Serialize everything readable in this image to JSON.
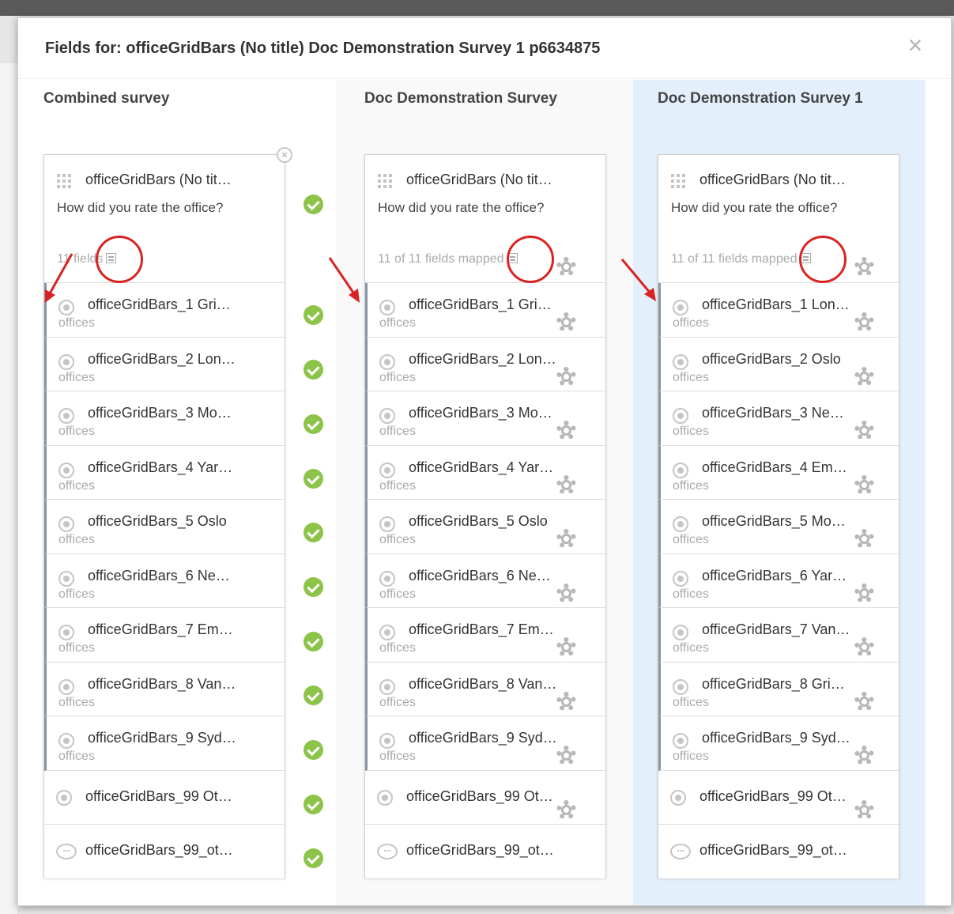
{
  "dialog": {
    "title": "Fields for: officeGridBars (No title) Doc Demonstration Survey 1 p6634875",
    "close_glyph": "×"
  },
  "icons": {
    "question": "grid-icon",
    "meta": "list-icon",
    "field": "radio-icon",
    "open_text": "chat-icon",
    "mapped": "check-icon",
    "settings": "gear-icon",
    "remove": "remove-icon"
  },
  "colors": {
    "check": "#8cc44a",
    "selected_column_bg": "#e3effa",
    "annotation": "#d92323",
    "mapped_bar": "#8896a8"
  },
  "columns": [
    {
      "title": "Combined survey",
      "question": {
        "title": "officeGridBars (No tit…",
        "text": "How did you rate the office?",
        "meta": "11 fields"
      },
      "fields": [
        {
          "label": "officeGridBars_1 Gri…",
          "sub": "offices"
        },
        {
          "label": "officeGridBars_2 Lon…",
          "sub": "offices"
        },
        {
          "label": "officeGridBars_3 Mo…",
          "sub": "offices"
        },
        {
          "label": "officeGridBars_4 Yar…",
          "sub": "offices"
        },
        {
          "label": "officeGridBars_5 Oslo",
          "sub": "offices"
        },
        {
          "label": "officeGridBars_6 Ne…",
          "sub": "offices"
        },
        {
          "label": "officeGridBars_7 Em…",
          "sub": "offices"
        },
        {
          "label": "officeGridBars_8 Van…",
          "sub": "offices"
        },
        {
          "label": "officeGridBars_9 Syd…",
          "sub": "offices"
        },
        {
          "label": "officeGridBars_99 Ot…",
          "sub": ""
        },
        {
          "label": "officeGridBars_99_ot…",
          "sub": ""
        }
      ]
    },
    {
      "title": "Doc Demonstration Survey",
      "question": {
        "title": "officeGridBars (No tit…",
        "text": "How did you rate the office?",
        "meta": "11 of 11 fields mapped"
      },
      "fields": [
        {
          "label": "officeGridBars_1 Gri…",
          "sub": "offices"
        },
        {
          "label": "officeGridBars_2 Lon…",
          "sub": "offices"
        },
        {
          "label": "officeGridBars_3 Mo…",
          "sub": "offices"
        },
        {
          "label": "officeGridBars_4 Yar…",
          "sub": "offices"
        },
        {
          "label": "officeGridBars_5 Oslo",
          "sub": "offices"
        },
        {
          "label": "officeGridBars_6 Ne…",
          "sub": "offices"
        },
        {
          "label": "officeGridBars_7 Em…",
          "sub": "offices"
        },
        {
          "label": "officeGridBars_8 Van…",
          "sub": "offices"
        },
        {
          "label": "officeGridBars_9 Syd…",
          "sub": "offices"
        },
        {
          "label": "officeGridBars_99 Ot…",
          "sub": ""
        },
        {
          "label": "officeGridBars_99_ot…",
          "sub": ""
        }
      ]
    },
    {
      "title": "Doc Demonstration Survey 1",
      "question": {
        "title": "officeGridBars (No tit…",
        "text": "How did you rate the office?",
        "meta": "11 of 11 fields mapped"
      },
      "fields": [
        {
          "label": "officeGridBars_1 Lon…",
          "sub": "offices"
        },
        {
          "label": "officeGridBars_2 Oslo",
          "sub": "offices"
        },
        {
          "label": "officeGridBars_3 Ne…",
          "sub": "offices"
        },
        {
          "label": "officeGridBars_4 Em…",
          "sub": "offices"
        },
        {
          "label": "officeGridBars_5 Mo…",
          "sub": "offices"
        },
        {
          "label": "officeGridBars_6 Yar…",
          "sub": "offices"
        },
        {
          "label": "officeGridBars_7 Van…",
          "sub": "offices"
        },
        {
          "label": "officeGridBars_8 Gri…",
          "sub": "offices"
        },
        {
          "label": "officeGridBars_9 Syd…",
          "sub": "offices"
        },
        {
          "label": "officeGridBars_99 Ot…",
          "sub": ""
        },
        {
          "label": "officeGridBars_99_ot…",
          "sub": ""
        }
      ]
    }
  ]
}
